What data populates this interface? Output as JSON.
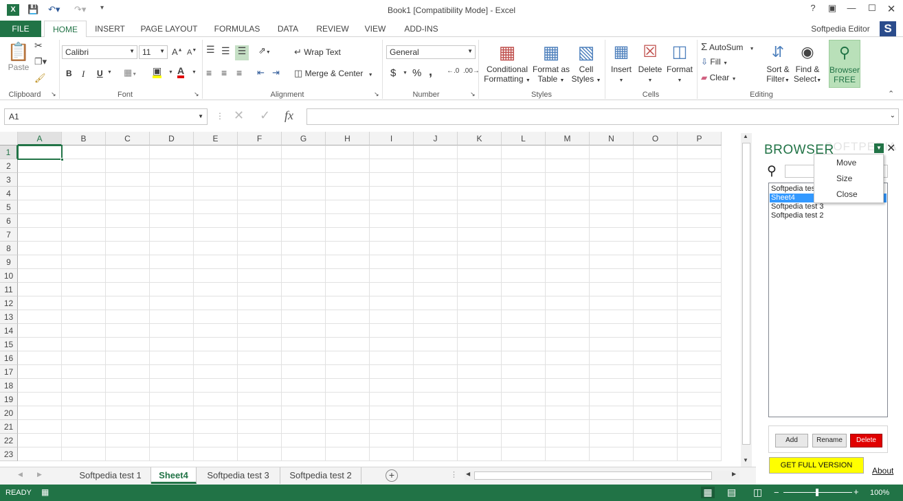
{
  "window": {
    "title": "Book1  [Compatibility Mode] - Excel"
  },
  "tabs": {
    "file": "FILE",
    "items": [
      "HOME",
      "INSERT",
      "PAGE LAYOUT",
      "FORMULAS",
      "DATA",
      "REVIEW",
      "VIEW",
      "ADD-INS"
    ],
    "user": "Softpedia Editor",
    "user_initial": "S"
  },
  "ribbon": {
    "clipboard": {
      "label": "Clipboard",
      "paste": "Paste"
    },
    "font": {
      "label": "Font",
      "name": "Calibri",
      "size": "11",
      "bold": "B",
      "italic": "I",
      "underline": "U"
    },
    "alignment": {
      "label": "Alignment",
      "wrap": "Wrap Text",
      "merge": "Merge & Center"
    },
    "number": {
      "label": "Number",
      "format": "General",
      "currency": "$",
      "percent": "%",
      "comma": ","
    },
    "styles": {
      "label": "Styles",
      "cond1": "Conditional",
      "cond2": "Formatting",
      "fmt1": "Format as",
      "fmt2": "Table",
      "cell1": "Cell",
      "cell2": "Styles"
    },
    "cells": {
      "label": "Cells",
      "insert": "Insert",
      "delete": "Delete",
      "format": "Format"
    },
    "editing": {
      "label": "Editing",
      "autosum": "AutoSum",
      "fill": "Fill",
      "clear": "Clear",
      "sort1": "Sort &",
      "sort2": "Filter",
      "find1": "Find &",
      "find2": "Select"
    },
    "browser": {
      "line1": "Browser",
      "line2": "FREE"
    }
  },
  "formula_bar": {
    "namebox": "A1",
    "fx": "fx",
    "value": ""
  },
  "columns": [
    "A",
    "B",
    "C",
    "D",
    "E",
    "F",
    "G",
    "H",
    "I",
    "J",
    "K",
    "L",
    "M",
    "N",
    "O",
    "P"
  ],
  "rows": [
    "1",
    "2",
    "3",
    "4",
    "5",
    "6",
    "7",
    "8",
    "9",
    "10",
    "11",
    "12",
    "13",
    "14",
    "15",
    "16",
    "17",
    "18",
    "19",
    "20",
    "21",
    "22",
    "23"
  ],
  "sheets": [
    "Softpedia test 1",
    "Sheet4",
    "Softpedia test 3",
    "Softpedia test 2"
  ],
  "active_sheet": "Sheet4",
  "status": {
    "ready": "READY",
    "zoom": "100%"
  },
  "browser_pane": {
    "title": "BROWSER",
    "watermark": "SOFTPEDIA",
    "list": [
      "Softpedia test 1",
      "Sheet4",
      "Softpedia test 3",
      "Softpedia test 2"
    ],
    "selected": "Sheet4",
    "add": "Add",
    "rename": "Rename",
    "delete": "Delete",
    "full_version": "GET FULL VERSION",
    "about": "About",
    "menu": [
      "Move",
      "Size",
      "Close"
    ]
  },
  "colors": {
    "excel_green": "#217346",
    "selection_blue": "#3399ff",
    "delete_red": "#e00000",
    "promo_yellow": "#ffff00"
  }
}
